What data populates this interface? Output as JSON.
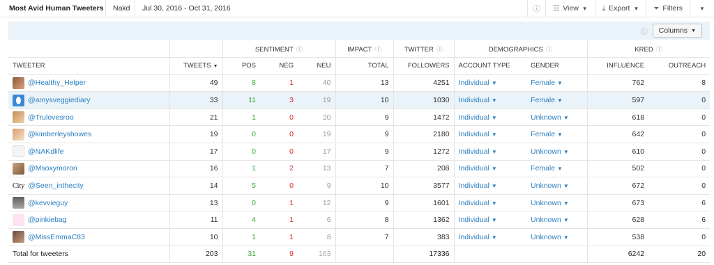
{
  "header": {
    "title": "Most Avid Human Tweeters",
    "brand": "Nakd",
    "date_range": "Jul 30, 2016 - Oct 31, 2016",
    "view_label": "View",
    "export_label": "Export",
    "filters_label": "Filters"
  },
  "toolbar": {
    "columns_label": "Columns"
  },
  "groups": {
    "sentiment": "SENTIMENT",
    "impact": "IMPACT",
    "twitter": "TWITTER",
    "demographics": "DEMOGRAPHICS",
    "kred": "KRED"
  },
  "columns": {
    "tweeter": "TWEETER",
    "tweets": "TWEETS",
    "pos": "POS",
    "neg": "NEG",
    "neu": "NEU",
    "total": "TOTAL",
    "followers": "FOLLOWERS",
    "account_type": "ACCOUNT TYPE",
    "gender": "GENDER",
    "influence": "INFLUENCE",
    "outreach": "OUTREACH"
  },
  "rows": [
    {
      "handle": "@Healthy_Helper",
      "tweets": "49",
      "pos": "8",
      "neg": "1",
      "neu": "40",
      "total": "13",
      "followers": "4251",
      "account_type": "Individual",
      "gender": "Female",
      "influence": "762",
      "outreach": "8"
    },
    {
      "handle": "@amysveggiediary",
      "tweets": "33",
      "pos": "11",
      "neg": "3",
      "neu": "19",
      "total": "10",
      "followers": "1030",
      "account_type": "Individual",
      "gender": "Female",
      "influence": "597",
      "outreach": "0"
    },
    {
      "handle": "@Trulovesroo",
      "tweets": "21",
      "pos": "1",
      "neg": "0",
      "neu": "20",
      "total": "9",
      "followers": "1472",
      "account_type": "Individual",
      "gender": "Unknown",
      "influence": "618",
      "outreach": "0"
    },
    {
      "handle": "@kimberleyshowes",
      "tweets": "19",
      "pos": "0",
      "neg": "0",
      "neu": "19",
      "total": "9",
      "followers": "2180",
      "account_type": "Individual",
      "gender": "Female",
      "influence": "642",
      "outreach": "0"
    },
    {
      "handle": "@NAKdlife",
      "tweets": "17",
      "pos": "0",
      "neg": "0",
      "neu": "17",
      "total": "9",
      "followers": "1272",
      "account_type": "Individual",
      "gender": "Unknown",
      "influence": "610",
      "outreach": "0"
    },
    {
      "handle": "@Msoxymoron",
      "tweets": "16",
      "pos": "1",
      "neg": "2",
      "neu": "13",
      "total": "7",
      "followers": "208",
      "account_type": "Individual",
      "gender": "Female",
      "influence": "502",
      "outreach": "0"
    },
    {
      "handle": "@Seen_inthecity",
      "avatar_text": "City",
      "tweets": "14",
      "pos": "5",
      "neg": "0",
      "neu": "9",
      "total": "10",
      "followers": "3577",
      "account_type": "Individual",
      "gender": "Unknown",
      "influence": "672",
      "outreach": "0"
    },
    {
      "handle": "@kevvieguy",
      "tweets": "13",
      "pos": "0",
      "neg": "1",
      "neu": "12",
      "total": "9",
      "followers": "1601",
      "account_type": "Individual",
      "gender": "Unknown",
      "influence": "673",
      "outreach": "6"
    },
    {
      "handle": "@pinkiebag",
      "tweets": "11",
      "pos": "4",
      "neg": "1",
      "neu": "6",
      "total": "8",
      "followers": "1362",
      "account_type": "Individual",
      "gender": "Unknown",
      "influence": "628",
      "outreach": "6"
    },
    {
      "handle": "@MissEmmaC83",
      "tweets": "10",
      "pos": "1",
      "neg": "1",
      "neu": "8",
      "total": "7",
      "followers": "383",
      "account_type": "Individual",
      "gender": "Unknown",
      "influence": "538",
      "outreach": "0"
    }
  ],
  "totals": {
    "label": "Total for tweeters",
    "tweets": "203",
    "pos": "31",
    "neg": "9",
    "neu": "163",
    "followers": "17336",
    "influence": "6242",
    "outreach": "20"
  },
  "colors": {
    "positive": "#3aa635",
    "negative": "#e0262a",
    "neutral": "#9a9a9a",
    "link": "#2a7fc1",
    "highlight": "#e9f3f9"
  },
  "icons": [
    "info-icon",
    "grid-view-icon",
    "download-icon",
    "filter-icon",
    "chevron-down-icon",
    "help-icon",
    "sort-desc-icon"
  ]
}
